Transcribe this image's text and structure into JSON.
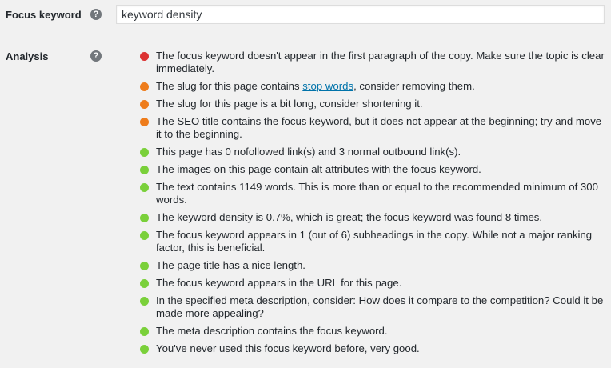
{
  "focus_keyword": {
    "label": "Focus keyword",
    "help": "?",
    "value": "keyword density"
  },
  "analysis": {
    "label": "Analysis",
    "help": "?",
    "colors": {
      "red": "#dc3232",
      "orange": "#ee7c1b",
      "green": "#7ad03a"
    },
    "items": [
      {
        "status": "red",
        "text": "The focus keyword doesn't appear in the first paragraph of the copy. Make sure the topic is clear immediately."
      },
      {
        "status": "orange",
        "pre": "The slug for this page contains ",
        "link": "stop words",
        "post": ", consider removing them."
      },
      {
        "status": "orange",
        "text": "The slug for this page is a bit long, consider shortening it."
      },
      {
        "status": "orange",
        "text": "The SEO title contains the focus keyword, but it does not appear at the beginning; try and move it to the beginning."
      },
      {
        "status": "green",
        "text": "This page has 0 nofollowed link(s) and 3 normal outbound link(s)."
      },
      {
        "status": "green",
        "text": "The images on this page contain alt attributes with the focus keyword."
      },
      {
        "status": "green",
        "text": "The text contains 1149 words. This is more than or equal to the recommended minimum of 300 words."
      },
      {
        "status": "green",
        "text": "The keyword density is 0.7%, which is great; the focus keyword was found 8 times."
      },
      {
        "status": "green",
        "text": "The focus keyword appears in 1 (out of 6) subheadings in the copy. While not a major ranking factor, this is beneficial."
      },
      {
        "status": "green",
        "text": "The page title has a nice length."
      },
      {
        "status": "green",
        "text": "The focus keyword appears in the URL for this page."
      },
      {
        "status": "green",
        "text": "In the specified meta description, consider: How does it compare to the competition? Could it be made more appealing?"
      },
      {
        "status": "green",
        "text": "The meta description contains the focus keyword."
      },
      {
        "status": "green",
        "text": "You've never used this focus keyword before, very good."
      }
    ]
  }
}
